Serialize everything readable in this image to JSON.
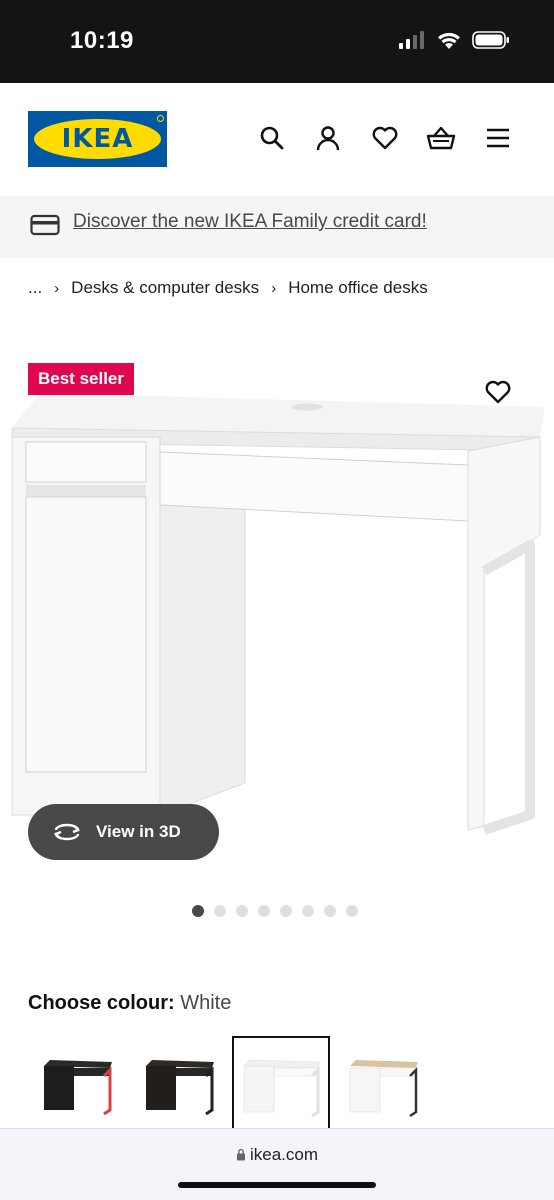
{
  "status_bar": {
    "time": "10:19"
  },
  "header": {
    "logo_text": "IKEA",
    "icons": [
      "search-icon",
      "account-icon",
      "heart-icon",
      "basket-icon",
      "menu-icon"
    ]
  },
  "promo": {
    "text": "Discover the new IKEA Family credit card!"
  },
  "breadcrumb": {
    "items": [
      "...",
      "Desks & computer desks",
      "Home office desks"
    ]
  },
  "product": {
    "badge": "Best seller",
    "view_3d_label": "View in 3D",
    "image_count": 8,
    "active_image_index": 0
  },
  "colour": {
    "label": "Choose colour:",
    "selected": "White",
    "options_count": 4,
    "selected_index": 2
  },
  "browser": {
    "url": "ikea.com"
  },
  "colors": {
    "brand_blue": "#0058a3",
    "brand_yellow": "#ffdb00",
    "badge_red": "#e00751",
    "button_grey": "#484848"
  }
}
